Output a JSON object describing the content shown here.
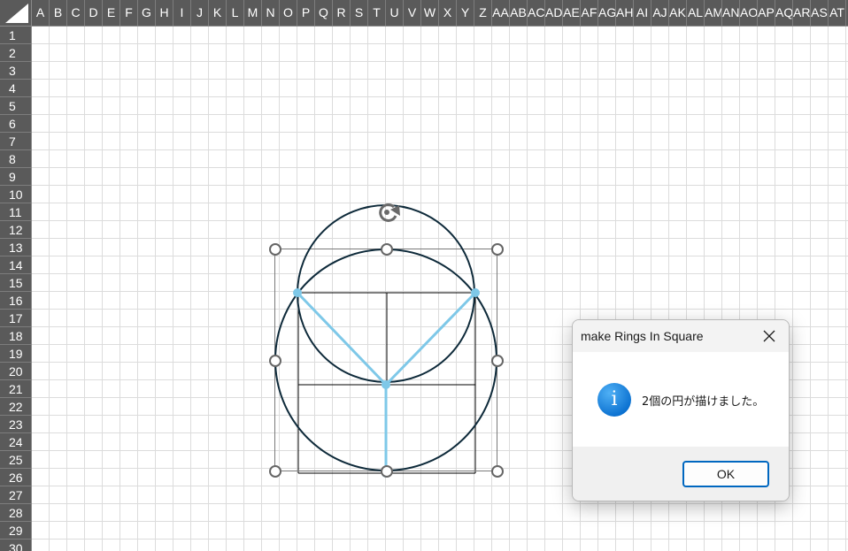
{
  "spreadsheet": {
    "columns": [
      "A",
      "B",
      "C",
      "D",
      "E",
      "F",
      "G",
      "H",
      "I",
      "J",
      "K",
      "L",
      "M",
      "N",
      "O",
      "P",
      "Q",
      "R",
      "S",
      "T",
      "U",
      "V",
      "W",
      "X",
      "Y",
      "Z",
      "AA",
      "AB",
      "AC",
      "AD",
      "AE",
      "AF",
      "AG",
      "AH",
      "AI",
      "AJ",
      "AK",
      "AL",
      "AM",
      "AN",
      "AO",
      "AP",
      "AQ",
      "AR",
      "AS",
      "AT"
    ],
    "rows": [
      "1",
      "2",
      "3",
      "4",
      "5",
      "6",
      "7",
      "8",
      "9",
      "10",
      "11",
      "12",
      "13",
      "14",
      "15",
      "16",
      "17",
      "18",
      "19",
      "20",
      "21",
      "22",
      "23",
      "24",
      "25",
      "26",
      "27",
      "28",
      "29",
      "30"
    ]
  },
  "drawing": {
    "circle_color": "#0e2a3a",
    "spoke_color": "#7ec8e8",
    "handle_color": "#666666",
    "selection_border_color": "#7a7a7a",
    "rotate_icon": "rotate-handle-icon"
  },
  "dialog": {
    "title": "make Rings In Square",
    "message": "2個の円が描けました。",
    "ok_label": "OK",
    "icon": "info-icon",
    "close_icon": "close-icon",
    "accent_color": "#0067c0"
  }
}
